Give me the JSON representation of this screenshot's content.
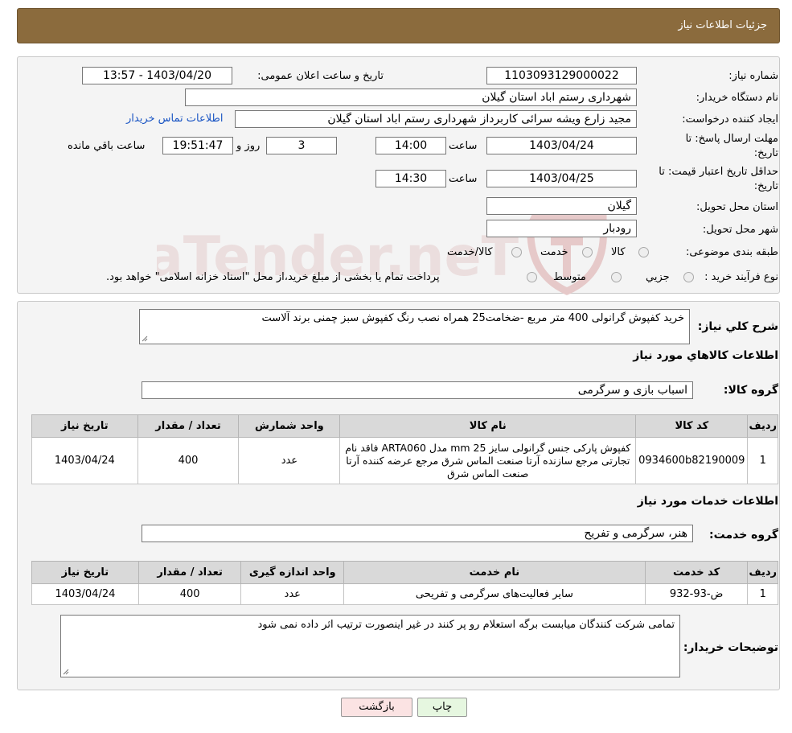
{
  "header": {
    "title": "جزئیات اطلاعات نیاز"
  },
  "details": {
    "need_number_label": "شماره نیاز:",
    "need_number": "1103093129000022",
    "announce_label": "تاریخ و ساعت اعلان عمومی:",
    "announce_value": "1403/04/20 - 13:57",
    "buyer_org_label": "نام دستگاه خریدار:",
    "buyer_org": "شهرداری رستم اباد استان گیلان",
    "creator_label": "ایجاد کننده درخواست:",
    "creator": "مجید زارع ویشه سرائی کاربرداز شهرداری رستم اباد استان گیلان",
    "contact_link": "اطلاعات تماس خریدار",
    "reply_deadline_label_1": "مهلت ارسال پاسخ: تا",
    "reply_deadline_label_2": "تاریخ:",
    "reply_date": "1403/04/24",
    "time_label": "ساعت",
    "reply_time": "14:00",
    "days": "3",
    "days_label": "روز و",
    "remaining_time": "19:51:47",
    "remaining_label": "ساعت باقي مانده",
    "price_validity_label_1": "حداقل تاریخ اعتبار قیمت: تا",
    "price_validity_label_2": "تاریخ:",
    "validity_date": "1403/04/25",
    "validity_time": "14:30",
    "province_label": "استان محل تحویل:",
    "province": "گیلان",
    "city_label": "شهر محل تحویل:",
    "city": "رودبار",
    "category_label": "طبقه بندی موضوعی:",
    "category_options": [
      "کالا",
      "خدمت",
      "کالا/خدمت"
    ],
    "process_label": "نوع فرآیند خرید :",
    "process_options": [
      "جزيي",
      "متوسط"
    ],
    "process_note": "پرداخت تمام یا بخشی از مبلغ خرید،از محل \"اسناد خزانه اسلامی\" خواهد بود."
  },
  "summary": {
    "label": "شرح کلي نياز:",
    "text": "خرید کفپوش گرانولی 400 متر مربع -ضخامت25 همراه نصب  رنگ کفپوش سبز چمنی برند آلاست"
  },
  "goods": {
    "section_title": "اطلاعات کالاهاي مورد نياز",
    "group_label": "گروه کالا:",
    "group_value": "اسباب بازی و سرگرمی",
    "columns": [
      "رديف",
      "کد کالا",
      "نام کالا",
      "واحد شمارش",
      "تعداد / مقدار",
      "تاريخ نياز"
    ],
    "rows": [
      {
        "row": "1",
        "code": "0934600b82190009",
        "name": "کفپوش پارکی جنس گرانولی سایز mm 25 مدل ARTA060 فاقد نام تجارتی مرجع سازنده آرتا صنعت الماس شرق مرجع عرضه کننده آرتا صنعت الماس شرق",
        "unit": "عدد",
        "qty": "400",
        "date": "1403/04/24"
      }
    ]
  },
  "services": {
    "section_title": "اطلاعات خدمات مورد نياز",
    "group_label": "گروه خدمت:",
    "group_value": "هنر، سرگرمی و تفریح",
    "columns": [
      "رديف",
      "کد خدمت",
      "نام خدمت",
      "واحد اندازه گيری",
      "تعداد / مقدار",
      "تاريخ نياز"
    ],
    "rows": [
      {
        "row": "1",
        "code": "ض-93-932",
        "name": "سایر فعالیت‌های سرگرمی و تفریحی",
        "unit": "عدد",
        "qty": "400",
        "date": "1403/04/24"
      }
    ]
  },
  "buyer_notes": {
    "label": "توضيحات خريدار:",
    "text": "تمامی شرکت کنندگان میابست برگه استعلام رو پر کنند در غیر اینصورت ترتیب اثر داده نمی شود"
  },
  "buttons": {
    "print": "چاپ",
    "back": "بازگشت"
  },
  "watermark": {
    "text": "AriaTender.neT"
  },
  "colors": {
    "header_bg": "#8b6b3d",
    "print_btn_bg": "#e6f7e0",
    "back_btn_bg": "#fbe3e3",
    "link": "#1a55c4"
  }
}
